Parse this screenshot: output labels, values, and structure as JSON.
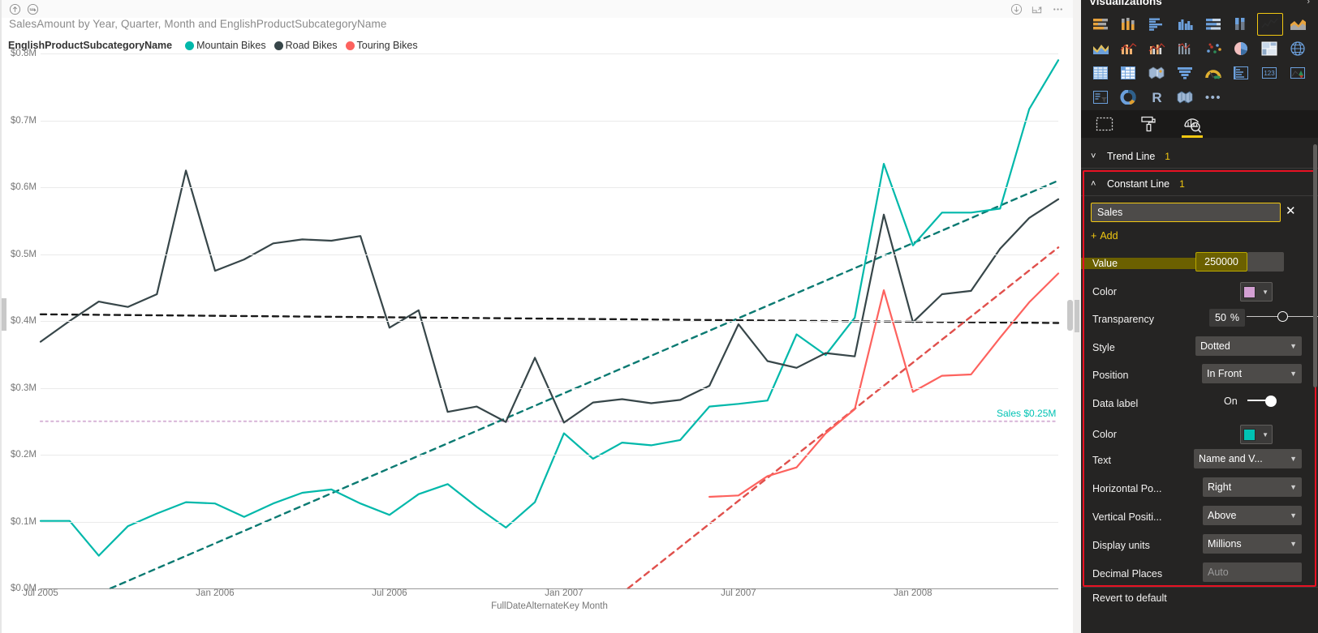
{
  "visual": {
    "header_icons": [
      "focus-mode-icon",
      "drill-mode-icon"
    ],
    "header_right_icons": [
      "export-data-icon",
      "focus-expand-icon",
      "more-options-icon"
    ],
    "title": "SalesAmount by Year, Quarter, Month and EnglishProductSubcategoryName",
    "legend_title": "EnglishProductSubcategoryName",
    "constant_line_label": "Sales $0.25M"
  },
  "chart_data": {
    "type": "line",
    "title": "SalesAmount by Year, Quarter, Month and EnglishProductSubcategoryName",
    "xlabel": "FullDateAlternateKey Month",
    "ylabel": "",
    "ylim": [
      0,
      800000
    ],
    "yticks": [
      "$0.0M",
      "$0.1M",
      "$0.2M",
      "$0.3M",
      "$0.4M",
      "$0.5M",
      "$0.6M",
      "$0.7M",
      "$0.8M"
    ],
    "ytick_values": [
      0,
      100000,
      200000,
      300000,
      400000,
      500000,
      600000,
      700000,
      800000
    ],
    "xticks": [
      "Jul 2005",
      "Jan 2006",
      "Jul 2006",
      "Jan 2007",
      "Jul 2007",
      "Jan 2008"
    ],
    "xtick_index": [
      0,
      6,
      12,
      18,
      24,
      30
    ],
    "x": [
      "Jul 2005",
      "Aug 2005",
      "Sep 2005",
      "Oct 2005",
      "Nov 2005",
      "Dec 2005",
      "Jan 2006",
      "Feb 2006",
      "Mar 2006",
      "Apr 2006",
      "May 2006",
      "Jun 2006",
      "Jul 2006",
      "Aug 2006",
      "Sep 2006",
      "Oct 2006",
      "Nov 2006",
      "Dec 2006",
      "Jan 2007",
      "Feb 2007",
      "Mar 2007",
      "Apr 2007",
      "May 2007",
      "Jun 2007",
      "Jul 2007",
      "Aug 2007",
      "Sep 2007",
      "Oct 2007",
      "Nov 2007",
      "Dec 2007",
      "Jan 2008",
      "Feb 2008",
      "Mar 2008",
      "Apr 2008",
      "May 2008",
      "Jun 2008"
    ],
    "grid": true,
    "legend_position": "top",
    "series": [
      {
        "name": "Mountain Bikes",
        "color": "#01B8AA",
        "values": [
          101000,
          101000,
          49000,
          93000,
          112000,
          129000,
          127000,
          107000,
          127000,
          143000,
          148000,
          127000,
          110000,
          141000,
          156000,
          122000,
          91000,
          129000,
          232000,
          194000,
          218000,
          214000,
          222000,
          272000,
          276000,
          281000,
          380000,
          349000,
          405000,
          635000,
          513000,
          562000,
          562000,
          568000,
          717000,
          790000
        ],
        "trend": {
          "name": "Mountain Bikes trend",
          "color": "#0B7A72",
          "style": "dashed",
          "start": [
            2.4,
            0
          ],
          "end": [
            35,
            610000
          ]
        }
      },
      {
        "name": "Road Bikes",
        "color": "#374649",
        "values": [
          369000,
          400000,
          429000,
          421000,
          440000,
          625000,
          475000,
          492000,
          516000,
          522000,
          520000,
          527000,
          390000,
          416000,
          264000,
          272000,
          249000,
          345000,
          248000,
          278000,
          283000,
          277000,
          282000,
          303000,
          395000,
          340000,
          330000,
          352000,
          347000,
          559000,
          398000,
          440000,
          445000,
          508000,
          554000,
          582000
        ],
        "trend": {
          "name": "Road Bikes trend",
          "color": "#1A1A1A",
          "style": "dashed",
          "start": [
            0,
            410000
          ],
          "end": [
            35,
            397000
          ]
        }
      },
      {
        "name": "Touring Bikes",
        "color": "#FD625E",
        "values": [
          null,
          null,
          null,
          null,
          null,
          null,
          null,
          null,
          null,
          null,
          null,
          null,
          null,
          null,
          null,
          null,
          null,
          null,
          null,
          null,
          null,
          null,
          null,
          137000,
          139000,
          168000,
          181000,
          232000,
          268000,
          446000,
          294000,
          318000,
          320000,
          375000,
          428000,
          471000
        ],
        "trend": {
          "name": "Touring Bikes trend",
          "color": "#E0504C",
          "style": "dashed",
          "start": [
            20.2,
            0
          ],
          "end": [
            35,
            510000
          ]
        }
      }
    ],
    "constant_line": {
      "name": "Sales",
      "value": 250000,
      "label": "Sales $0.25M",
      "color": "#D9B8D9",
      "style": "dotted"
    }
  },
  "pane": {
    "title": "Visualizations",
    "collapse_icon": "chevron-right-icon",
    "viz_icons": [
      "stacked-bar-chart-icon",
      "stacked-column-chart-icon",
      "clustered-bar-chart-icon",
      "clustered-column-chart-icon",
      "100-stacked-bar-chart-icon",
      "100-stacked-column-chart-icon",
      "line-chart-icon",
      "area-chart-icon",
      "stacked-area-chart-icon",
      "line-and-stacked-column-chart-icon",
      "line-and-clustered-column-chart-icon",
      "ribbon-chart-icon",
      "scatter-chart-icon",
      "pie-chart-icon",
      "treemap-icon",
      "map-icon",
      "table-icon",
      "matrix-icon",
      "filled-map-icon",
      "funnel-icon",
      "gauge-icon",
      "multi-row-card-icon",
      "card-icon",
      "kpi-icon",
      "slicer-icon",
      "donut-chart-icon",
      "r-script-visual-icon",
      "azure-map-icon",
      "more-visuals-icon"
    ],
    "selected_viz": "line-chart-icon",
    "tabs": [
      {
        "name": "fields-tab",
        "icon": "fields-icon",
        "active": false
      },
      {
        "name": "format-tab",
        "icon": "paint-roller-icon",
        "active": false
      },
      {
        "name": "analytics-tab",
        "icon": "magnifier-chart-icon",
        "active": true
      }
    ],
    "trend_line": {
      "label": "Trend Line",
      "count": "1",
      "caret": "chevron-down-icon"
    },
    "constant_line": {
      "label": "Constant Line",
      "count": "1",
      "caret": "chevron-up-icon"
    },
    "card_name": "Sales",
    "add_label": "Add",
    "add_icon": "plus-icon",
    "remove_icon": "close-icon",
    "properties": [
      {
        "name": "value",
        "label": "Value",
        "value": "250000",
        "control": "textbox-highlighted"
      },
      {
        "name": "line-color",
        "label": "Color",
        "value": "#D3A0D3",
        "control": "color-swatch"
      },
      {
        "name": "transparency",
        "label": "Transparency",
        "value": "50",
        "unit": "%",
        "control": "percent-slider"
      },
      {
        "name": "style",
        "label": "Style",
        "value": "Dotted",
        "control": "dropdown"
      },
      {
        "name": "position",
        "label": "Position",
        "value": "In Front",
        "control": "dropdown"
      },
      {
        "name": "data-label",
        "label": "Data label",
        "value": "On",
        "control": "toggle"
      },
      {
        "name": "label-color",
        "label": "Color",
        "value": "#00C3B4",
        "control": "color-swatch"
      },
      {
        "name": "text",
        "label": "Text",
        "value": "Name and V...",
        "control": "dropdown"
      },
      {
        "name": "horizontal-position",
        "label": "Horizontal Po...",
        "value": "Right",
        "control": "dropdown"
      },
      {
        "name": "vertical-position",
        "label": "Vertical Positi...",
        "value": "Above",
        "control": "dropdown"
      },
      {
        "name": "display-units",
        "label": "Display units",
        "value": "Millions",
        "control": "dropdown"
      },
      {
        "name": "decimal-places",
        "label": "Decimal Places",
        "value": "Auto",
        "control": "dropdown-placeholder"
      }
    ],
    "revert_label": "Revert to default"
  }
}
